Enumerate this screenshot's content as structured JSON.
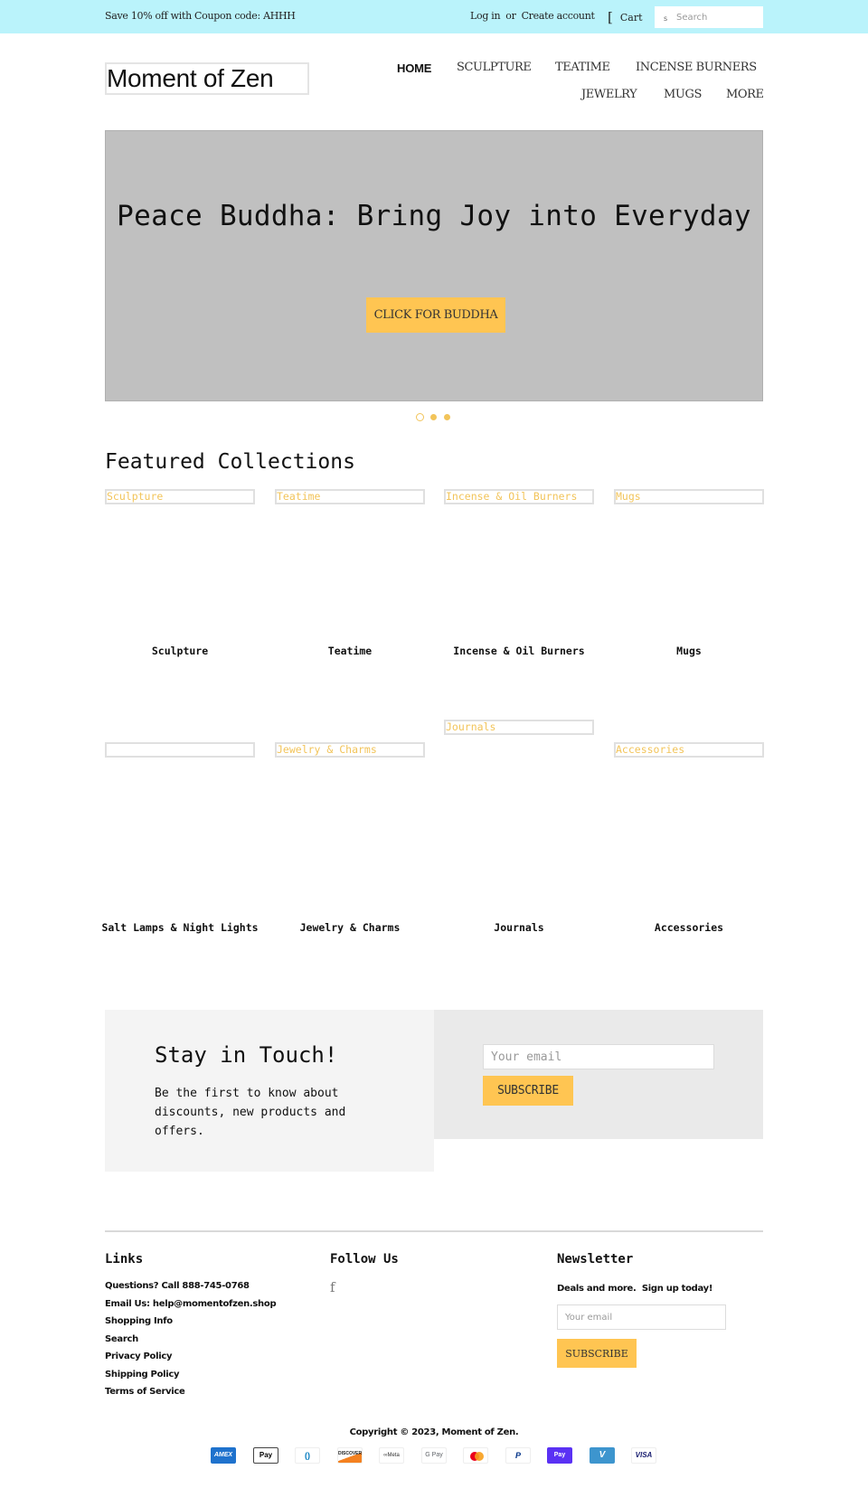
{
  "announcement": {
    "promo_text": "Save 10% off with Coupon code: AHHH",
    "login_label": "Log in",
    "or_label": "or",
    "create_account_label": "Create account",
    "cart_icon": "cart-icon",
    "cart_label": "Cart",
    "search_icon_glyph": "s",
    "search_placeholder": "Search"
  },
  "header": {
    "logo_text": "Moment of Zen",
    "nav": [
      {
        "label": "HOME",
        "active": true
      },
      {
        "label": "SCULPTURE",
        "active": false
      },
      {
        "label": "TEATIME",
        "active": false
      },
      {
        "label": "INCENSE BURNERS",
        "active": false
      },
      {
        "label": "JEWELRY",
        "active": false
      },
      {
        "label": "MUGS",
        "active": false
      },
      {
        "label": "MORE",
        "active": false
      }
    ]
  },
  "hero": {
    "title": "Peace Buddha: Bring Joy into Everyday",
    "button_label": "CLICK FOR BUDDHA",
    "slide_count": 3,
    "active_slide": 1
  },
  "featured": {
    "title": "Featured Collections",
    "collections": [
      {
        "image_alt": "Sculpture",
        "title": "Sculpture"
      },
      {
        "image_alt": "Teatime",
        "title": "Teatime"
      },
      {
        "image_alt": "Incense & Oil Burners",
        "title": "Incense & Oil Burners"
      },
      {
        "image_alt": "Mugs",
        "title": "Mugs"
      },
      {
        "image_alt": "",
        "title": "Salt Lamps & Night Lights"
      },
      {
        "image_alt": "Jewelry & Charms",
        "title": "Jewelry & Charms"
      },
      {
        "image_alt": "Journals",
        "title": "Journals"
      },
      {
        "image_alt": "Accessories",
        "title": "Accessories"
      }
    ]
  },
  "stay_in_touch": {
    "title": "Stay in Touch!",
    "body": "Be the first to know about discounts, new products and offers.",
    "email_placeholder": "Your email",
    "button_label": "SUBSCRIBE"
  },
  "footer": {
    "links_title": "Links",
    "links": [
      "Questions? Call 888-745-0768",
      "Email Us: help@momentofzen.shop",
      "Shopping Info",
      "Search",
      "Privacy Policy",
      "Shipping Policy",
      "Terms of Service"
    ],
    "follow_title": "Follow Us",
    "facebook_glyph": "f",
    "newsletter_title": "Newsletter",
    "newsletter_text": "Deals and more.  Sign up today!",
    "newsletter_placeholder": "Your email",
    "newsletter_button": "SUBSCRIBE",
    "copyright": "Copyright © 2023, Moment of Zen.",
    "payment_methods": [
      {
        "name": "American Express",
        "label": "AMEX"
      },
      {
        "name": "Apple Pay",
        "label": " Pay"
      },
      {
        "name": "Diners Club",
        "label": "()"
      },
      {
        "name": "Discover",
        "label": "DISCOVER"
      },
      {
        "name": "Meta Pay",
        "label": "∞Meta"
      },
      {
        "name": "Google Pay",
        "label": "G Pay"
      },
      {
        "name": "Mastercard",
        "label": ""
      },
      {
        "name": "PayPal",
        "label": "P"
      },
      {
        "name": "Shop Pay",
        "label": "Pay"
      },
      {
        "name": "Venmo",
        "label": "V"
      },
      {
        "name": "Visa",
        "label": "VISA"
      }
    ]
  },
  "colors": {
    "announcement_bg": "#baf3fb",
    "accent": "#ffc552",
    "hero_bg": "#c0c0c0",
    "collection_alt_text": "#f2c45a"
  }
}
